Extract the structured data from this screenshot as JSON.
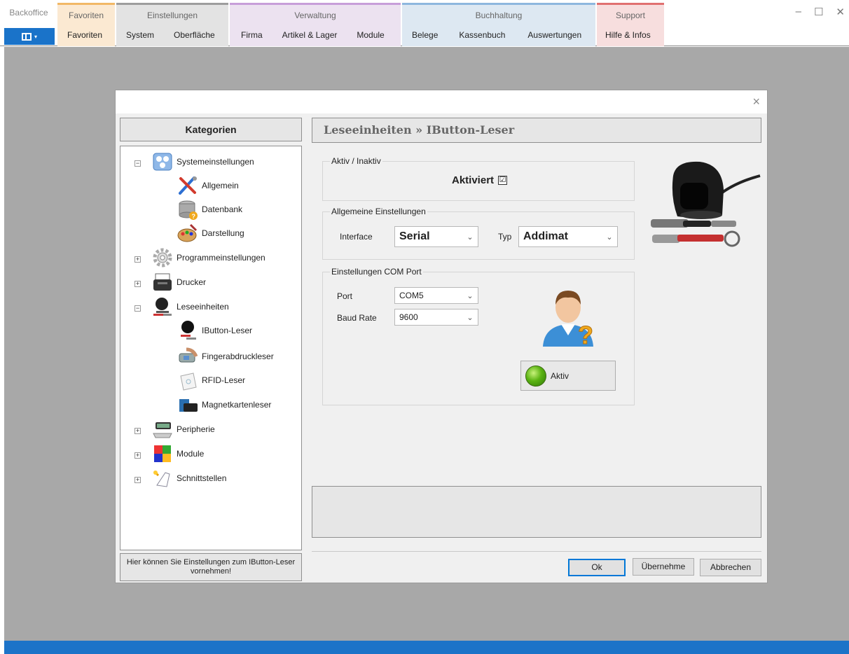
{
  "ribbon": {
    "brand": {
      "title": "Backoffice"
    },
    "groups": [
      {
        "title": "Favoriten",
        "items": [
          "Favoriten"
        ]
      },
      {
        "title": "Einstellungen",
        "items": [
          "System",
          "Oberfläche"
        ]
      },
      {
        "title": "Verwaltung",
        "items": [
          "Firma",
          "Artikel & Lager",
          "Module"
        ]
      },
      {
        "title": "Buchhaltung",
        "items": [
          "Belege",
          "Kassenbuch",
          "Auswertungen"
        ]
      },
      {
        "title": "Support",
        "items": [
          "Hilfe & Infos"
        ]
      }
    ],
    "window_controls": {
      "minimize": "–",
      "maximize": "☐",
      "close": "✕"
    }
  },
  "dialog": {
    "close": "×",
    "categories_title": "Kategorien",
    "tree": [
      {
        "label": "Systemeinstellungen",
        "expander": "−"
      },
      {
        "label": "Allgemein"
      },
      {
        "label": "Datenbank"
      },
      {
        "label": "Darstellung"
      },
      {
        "label": "Programmeinstellungen",
        "expander": "+"
      },
      {
        "label": "Drucker",
        "expander": "+"
      },
      {
        "label": "Leseeinheiten",
        "expander": "−"
      },
      {
        "label": "IButton-Leser"
      },
      {
        "label": "Fingerabdruckleser"
      },
      {
        "label": "RFID-Leser"
      },
      {
        "label": "Magnetkartenleser"
      },
      {
        "label": "Peripherie",
        "expander": "+"
      },
      {
        "label": "Module",
        "expander": "+"
      },
      {
        "label": "Schnittstellen",
        "expander": "+"
      }
    ],
    "hint": "Hier können Sie Einstellungen zum IButton-Leser vornehmen!",
    "section_title": "Leseeinheiten » IButton-Leser",
    "aktiv_group": {
      "legend": "Aktiv / Inaktiv",
      "label": "Aktiviert",
      "check": "☑"
    },
    "allg_group": {
      "legend": "Allgemeine Einstellungen",
      "interface_label": "Interface",
      "interface_value": "Serial",
      "typ_label": "Typ",
      "typ_value": "Addimat"
    },
    "com_group": {
      "legend": "Einstellungen COM Port",
      "port_label": "Port",
      "port_value": "COM5",
      "baud_label": "Baud Rate",
      "baud_value": "9600"
    },
    "aktiv_button": "Aktiv",
    "buttons": {
      "ok": "Ok",
      "apply": "Übernehme",
      "cancel": "Abbrechen"
    },
    "dropdown_glyph": "⌄"
  },
  "colors": {
    "accent_blue": "#1c73c8",
    "workspace": "#a8a8a8",
    "fav": "#fbe9d2",
    "einst": "#e3e3e3",
    "verw": "#ece2f0",
    "buch": "#dde8f2",
    "supp": "#f7dede"
  }
}
